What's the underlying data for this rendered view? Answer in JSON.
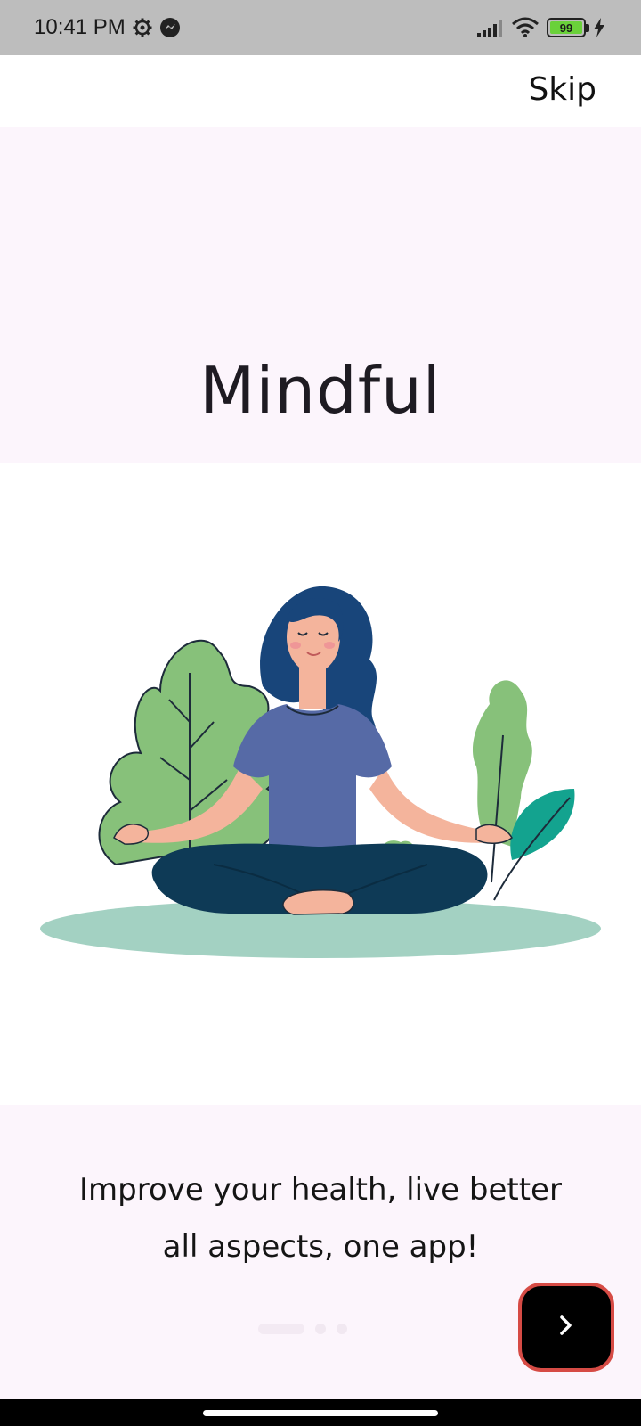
{
  "status_bar": {
    "time": "10:41 PM",
    "battery": "99",
    "icons": [
      "settings-gear-icon",
      "messenger-icon",
      "signal-icon",
      "wifi-icon",
      "battery-icon",
      "charging-icon"
    ]
  },
  "header": {
    "skip_label": "Skip"
  },
  "onboarding": {
    "title": "Mindful",
    "tagline_line1": "Improve your health, live better",
    "tagline_line2": "all aspects, one app!",
    "page_count": 3,
    "active_page": 1,
    "illustration": "meditating-woman-with-plants"
  },
  "next_button": {
    "icon": "chevron-right-icon"
  },
  "colors": {
    "title_background": "#fcf5fc",
    "next_button_background": "#000000",
    "next_button_border": "#d64b45",
    "status_bar": "#bdbdbd"
  }
}
